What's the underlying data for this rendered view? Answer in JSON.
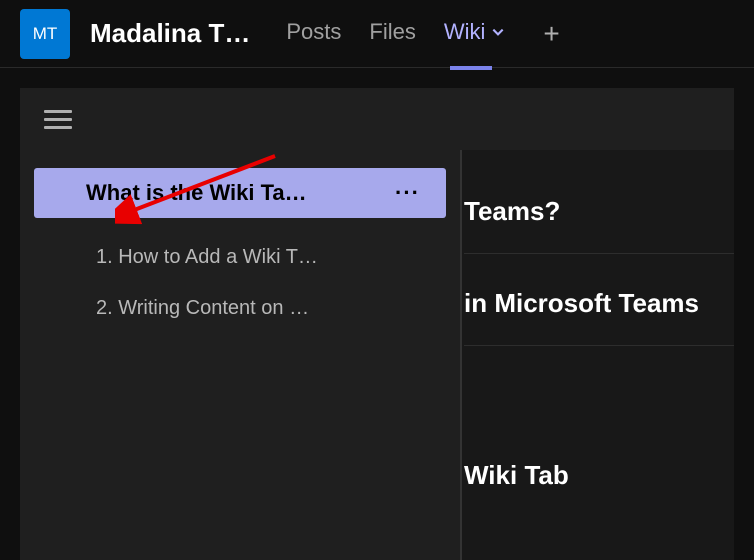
{
  "header": {
    "avatar_initials": "MT",
    "channel_name": "Madalina T…",
    "tabs": [
      {
        "label": "Posts"
      },
      {
        "label": "Files"
      },
      {
        "label": "Wiki"
      }
    ],
    "add_tab_glyph": "+"
  },
  "wiki_nav": {
    "current_page": {
      "title": "What is the Wiki Ta…",
      "more_glyph": "···"
    },
    "sections": [
      "1. How to Add a Wiki T…",
      "2. Writing Content on …"
    ]
  },
  "content_fragments": [
    "Teams?",
    "in Microsoft Teams",
    "Wiki Tab"
  ]
}
